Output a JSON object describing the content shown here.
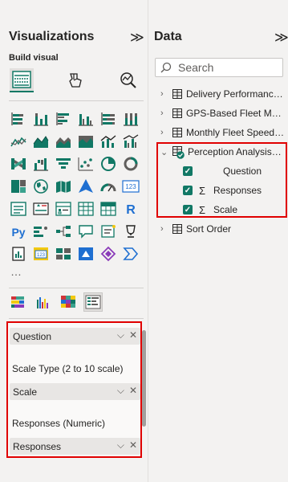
{
  "visualizations": {
    "title": "Visualizations",
    "collapse_glyph": "≫",
    "build_visual_label": "Build visual",
    "more_glyph": "…",
    "wells": [
      {
        "type": "field",
        "label": "Question"
      },
      {
        "type": "label",
        "label": "Scale Type (2 to 10 scale)"
      },
      {
        "type": "field",
        "label": "Scale"
      },
      {
        "type": "label",
        "label": "Responses (Numeric)"
      },
      {
        "type": "field",
        "label": "Responses"
      }
    ],
    "field_controls": {
      "expand": "⌵",
      "remove": "✕"
    }
  },
  "data": {
    "title": "Data",
    "collapse_glyph": "≫",
    "search_placeholder": "Search",
    "tables": [
      {
        "name": "Delivery Performance ...",
        "expanded": false
      },
      {
        "name": "GPS-Based Fleet Mov...",
        "expanded": false
      },
      {
        "name": "Monthly Fleet Speed, ...",
        "expanded": false
      },
      {
        "name": "Perception Analysis of...",
        "expanded": true
      },
      {
        "name": "Sort Order",
        "expanded": false
      }
    ],
    "fields": [
      {
        "name": "Question",
        "checked": true,
        "sigma": false
      },
      {
        "name": "Responses",
        "checked": true,
        "sigma": true
      },
      {
        "name": "Scale",
        "checked": true,
        "sigma": true
      }
    ],
    "sigma_glyph": "Σ",
    "check_glyph": "✓"
  },
  "colors": {
    "accent": "#117865",
    "highlight_border": "#e00000",
    "pane_bg": "#f3f2f1"
  }
}
